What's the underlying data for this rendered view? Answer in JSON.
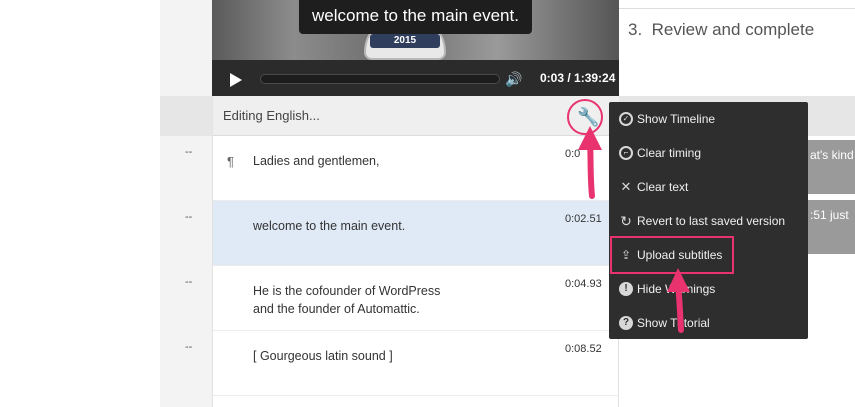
{
  "video": {
    "caption": "welcome to the main event.",
    "badge_year": "2015",
    "current_time": "0:03",
    "duration": "1:39:24",
    "time_display": "0:03 / 1:39:24",
    "progress": 0.0
  },
  "steps": {
    "review_number": "3.",
    "review_label": "Review and complete"
  },
  "editor": {
    "title": "Editing English...",
    "rows": [
      {
        "dash": "--",
        "text": "Ladies and gentlemen,",
        "time": "0:0",
        "pilcrow": "¶"
      },
      {
        "dash": "--",
        "text": "welcome to the main event.",
        "time": "0:02.51",
        "highlighted": true
      },
      {
        "dash": "--",
        "text": "He is the cofounder of WordPress\nand the founder of Automattic.",
        "time": "0:04.93"
      },
      {
        "dash": "--",
        "text": "[ Gourgeous latin sound ]",
        "time": "0:08.52"
      }
    ]
  },
  "right_cells": [
    "at's kind",
    ":51 just"
  ],
  "menu": {
    "items": [
      {
        "label": "Show Timeline",
        "icon": "check-circle-icon"
      },
      {
        "label": "Clear timing",
        "icon": "clock-icon"
      },
      {
        "label": "Clear text",
        "icon": "x-icon"
      },
      {
        "label": "Revert to last saved version",
        "icon": "undo-icon"
      },
      {
        "label": "Upload subtitles",
        "icon": "upload-icon"
      },
      {
        "label": "Hide Warnings",
        "icon": "warning-icon"
      },
      {
        "label": "Show Tutorial",
        "icon": "help-icon"
      }
    ]
  },
  "colors": {
    "highlight_pink": "#e8336f",
    "menu_bg": "#2e2e2e",
    "row_highlight": "#dfeaf6"
  }
}
